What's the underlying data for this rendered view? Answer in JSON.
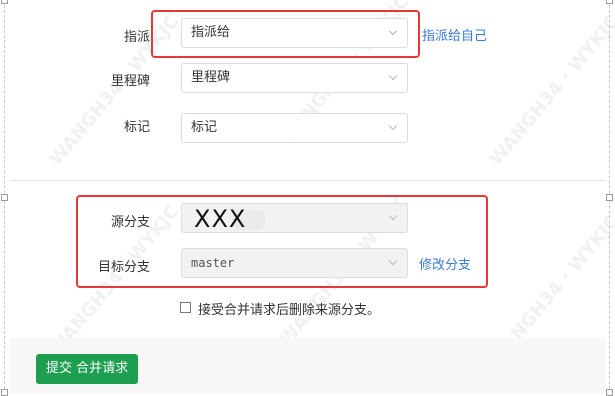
{
  "form": {
    "assignee": {
      "label": "指派",
      "value": "指派给",
      "link": "指派给自己"
    },
    "milestone": {
      "label": "里程碑",
      "value": "里程碑"
    },
    "tags": {
      "label": "标记",
      "value": "标记"
    },
    "source_branch": {
      "label": "源分支",
      "value": "XXX"
    },
    "target_branch": {
      "label": "目标分支",
      "value": "master",
      "link": "修改分支"
    },
    "delete_source_checkbox": {
      "label": "接受合并请求后删除来源分支。",
      "checked": false
    },
    "submit_button": {
      "label": "提交 合并请求"
    }
  },
  "colors": {
    "accent_link": "#3a7bd5",
    "submit_green": "#1e9e4f",
    "annotation_red": "#e53935"
  }
}
